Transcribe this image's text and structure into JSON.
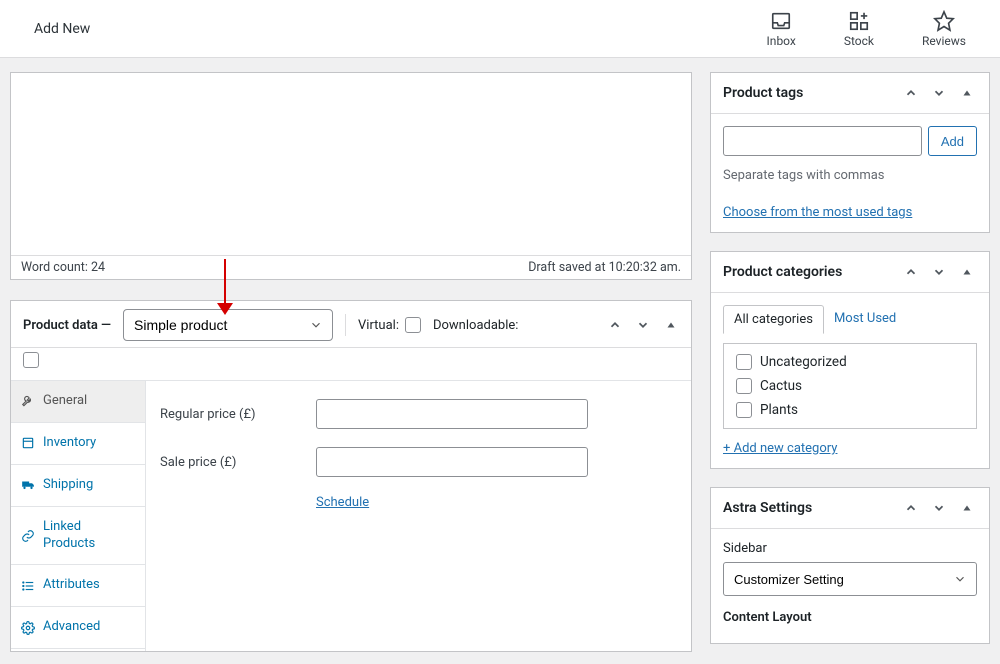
{
  "topbar": {
    "title": "Add New",
    "icons": {
      "inbox": "Inbox",
      "stock": "Stock",
      "reviews": "Reviews"
    }
  },
  "editor": {
    "wordcount_label": "Word count: 24",
    "draft_saved": "Draft saved at 10:20:32 am."
  },
  "product_data": {
    "title": "Product data —",
    "dropdown_value": "Simple product",
    "virtual_label": "Virtual:",
    "downloadable_label": "Downloadable:",
    "tabs": [
      "General",
      "Inventory",
      "Shipping",
      "Linked Products",
      "Attributes",
      "Advanced"
    ],
    "regular_price_label": "Regular price (£)",
    "sale_price_label": "Sale price (£)",
    "schedule_link": "Schedule"
  },
  "tags_panel": {
    "title": "Product tags",
    "add_button": "Add",
    "help": "Separate tags with commas",
    "choose_link": "Choose from the most used tags"
  },
  "categories_panel": {
    "title": "Product categories",
    "tab_all": "All categories",
    "tab_most": "Most Used",
    "items": [
      "Uncategorized",
      "Cactus",
      "Plants"
    ],
    "add_link": "+ Add new category"
  },
  "astra_panel": {
    "title": "Astra Settings",
    "sidebar_label": "Sidebar",
    "sidebar_value": "Customizer Setting",
    "content_layout_label": "Content Layout"
  }
}
